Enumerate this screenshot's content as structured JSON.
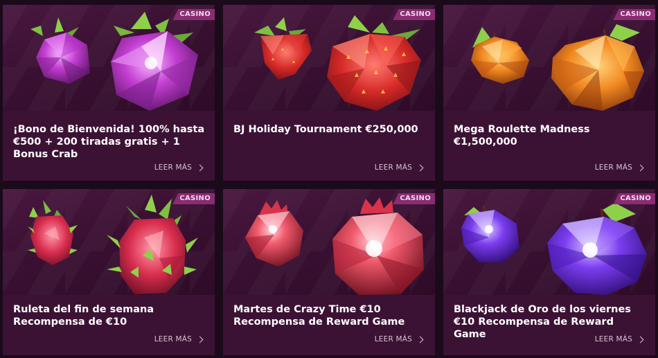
{
  "badge_label": "CASINO",
  "more_label": "LEER MÁS",
  "cards": [
    {
      "title": "¡Bono de Bienvenida! 100% hasta €500 + 200 tiradas gratis + 1 Bonus Crab",
      "fruit": "raspberry",
      "color": "#c53fd0"
    },
    {
      "title": "BJ Holiday Tournament €250,000",
      "fruit": "strawberry",
      "color": "#d9322f"
    },
    {
      "title": "Mega Roulette Madness €1,500,000",
      "fruit": "orange",
      "color": "#f0801f"
    },
    {
      "title": "Ruleta del fin de semana Recompensa de €10",
      "fruit": "dragonfruit",
      "color": "#e0335a"
    },
    {
      "title": "Martes de Crazy Time €10 Recompensa de Reward Game",
      "fruit": "pomegranate",
      "color": "#d93048"
    },
    {
      "title": "Blackjack de Oro de los viernes €10 Recompensa de Reward Game",
      "fruit": "plum",
      "color": "#6a2fe0"
    }
  ]
}
